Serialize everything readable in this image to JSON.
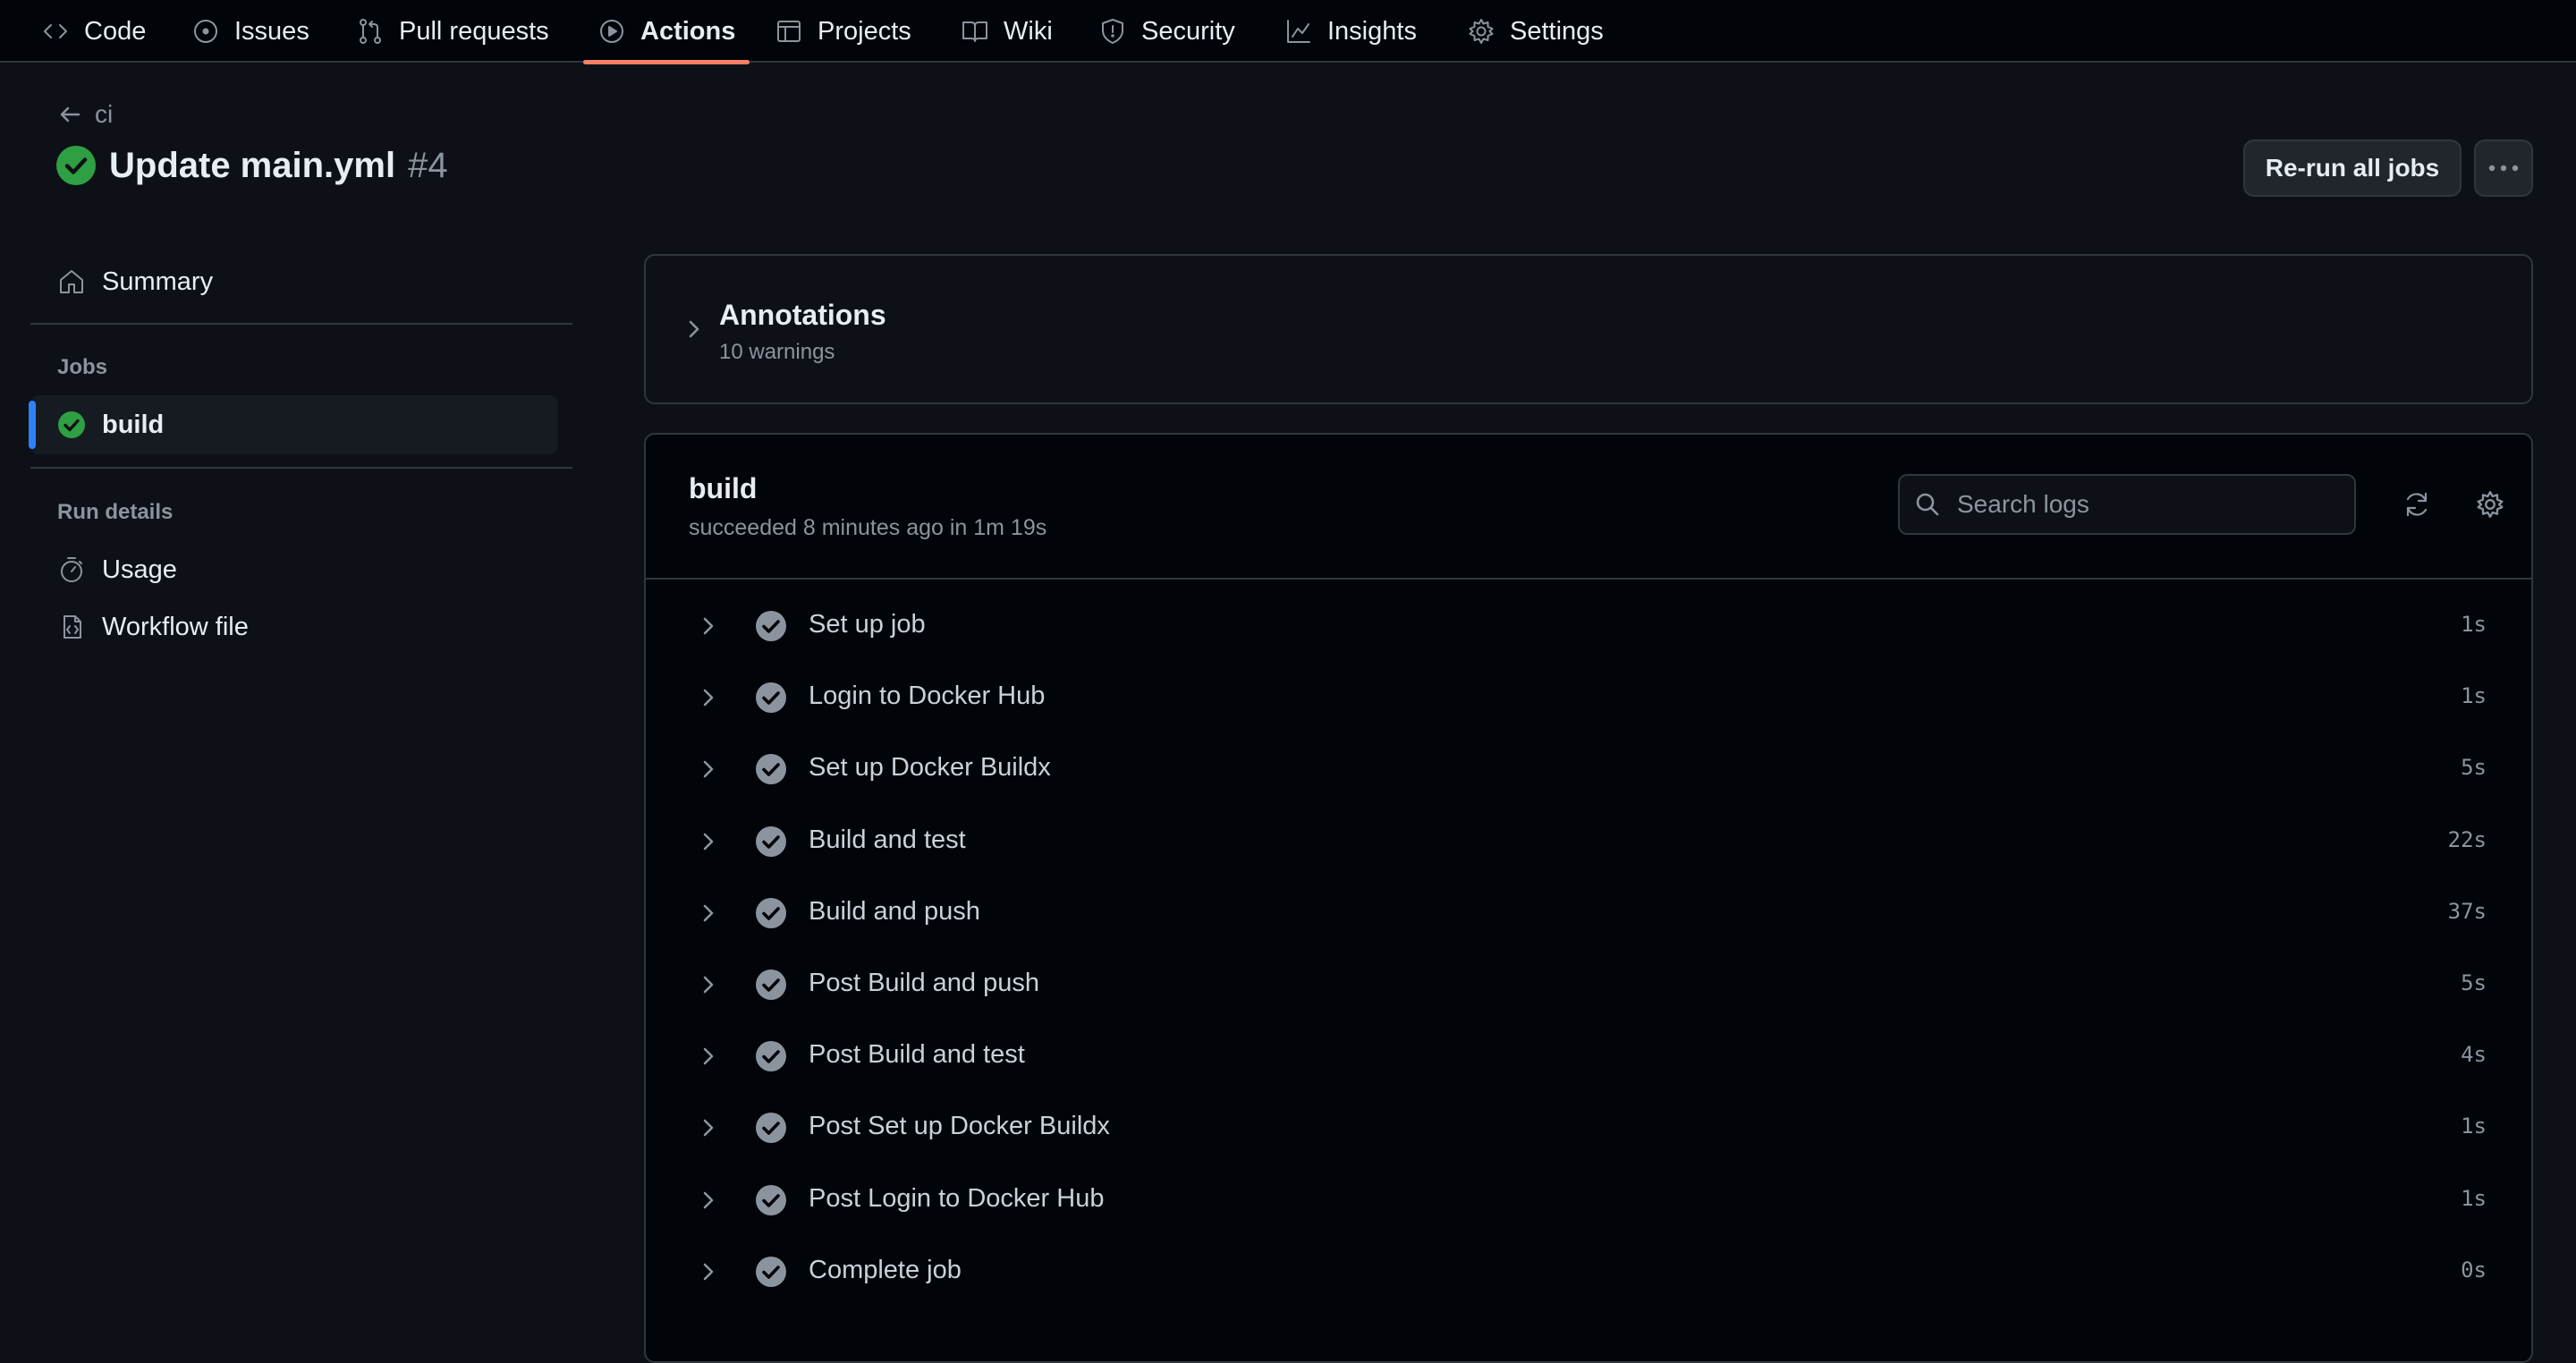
{
  "nav": {
    "tabs": [
      {
        "label": "Code",
        "icon": "code-icon"
      },
      {
        "label": "Issues",
        "icon": "issue-icon"
      },
      {
        "label": "Pull requests",
        "icon": "pull-request-icon"
      },
      {
        "label": "Actions",
        "icon": "play-icon",
        "active": true
      },
      {
        "label": "Projects",
        "icon": "table-icon"
      },
      {
        "label": "Wiki",
        "icon": "book-icon"
      },
      {
        "label": "Security",
        "icon": "shield-icon"
      },
      {
        "label": "Insights",
        "icon": "graph-icon"
      },
      {
        "label": "Settings",
        "icon": "gear-icon"
      }
    ]
  },
  "header": {
    "back_label": "ci",
    "title": "Update main.yml",
    "run_number": "#4",
    "rerun_label": "Re-run all jobs",
    "more_label": "···"
  },
  "sidebar": {
    "summary_label": "Summary",
    "jobs_heading": "Jobs",
    "job_label": "build",
    "run_details_heading": "Run details",
    "usage_label": "Usage",
    "workflow_label": "Workflow file"
  },
  "annotations": {
    "title": "Annotations",
    "subtitle": "10 warnings"
  },
  "build": {
    "title": "build",
    "status": "succeeded 8 minutes ago in 1m 19s",
    "search_placeholder": "Search logs",
    "steps": [
      {
        "name": "Set up job",
        "duration": "1s"
      },
      {
        "name": "Login to Docker Hub",
        "duration": "1s"
      },
      {
        "name": "Set up Docker Buildx",
        "duration": "5s"
      },
      {
        "name": "Build and test",
        "duration": "22s"
      },
      {
        "name": "Build and push",
        "duration": "37s"
      },
      {
        "name": "Post Build and push",
        "duration": "5s"
      },
      {
        "name": "Post Build and test",
        "duration": "4s"
      },
      {
        "name": "Post Set up Docker Buildx",
        "duration": "1s"
      },
      {
        "name": "Post Login to Docker Hub",
        "duration": "1s"
      },
      {
        "name": "Complete job",
        "duration": "0s"
      }
    ]
  },
  "colors": {
    "success": "#2ea043",
    "step_check": "#8b949e",
    "accent": "#f78166",
    "selected_bar": "#2f81f7"
  }
}
